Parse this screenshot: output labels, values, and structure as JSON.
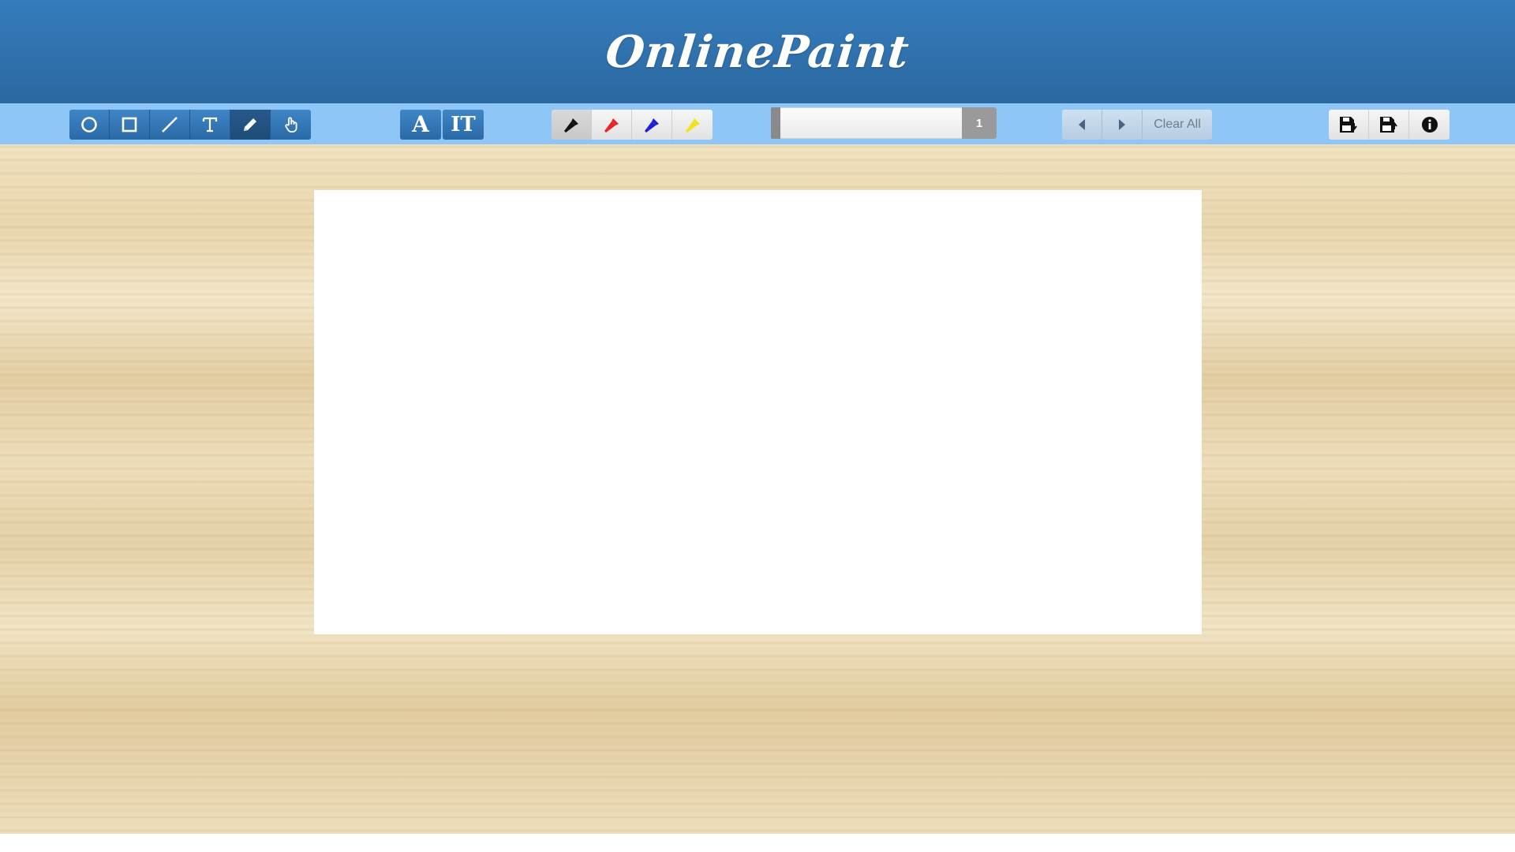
{
  "header": {
    "title": "OnlinePaint"
  },
  "toolbar": {
    "shape_tools": [
      {
        "name": "circle-tool",
        "icon": "circle-icon"
      },
      {
        "name": "rectangle-tool",
        "icon": "square-icon"
      },
      {
        "name": "line-tool",
        "icon": "line-icon"
      },
      {
        "name": "text-tool",
        "icon": "text-icon"
      },
      {
        "name": "pencil-tool",
        "icon": "pencil-icon",
        "active": true
      },
      {
        "name": "hand-tool",
        "icon": "hand-pointer-icon"
      }
    ],
    "font_tools": [
      {
        "name": "font-style-tool",
        "icon": "font-icon",
        "glyph": "A"
      },
      {
        "name": "font-size-tool",
        "icon": "text-height-icon",
        "glyph": "IT"
      }
    ],
    "colors": [
      {
        "name": "black",
        "hex": "#111111",
        "active": true
      },
      {
        "name": "red",
        "hex": "#e8232a"
      },
      {
        "name": "blue",
        "hex": "#1c1fd6"
      },
      {
        "name": "yellow",
        "hex": "#f2e21b"
      }
    ],
    "brush_size": {
      "value": "1"
    },
    "history": {
      "undo_icon": "caret-left-icon",
      "redo_icon": "caret-right-icon",
      "clear_label": "Clear All"
    },
    "file": [
      {
        "name": "save",
        "icon": "save-download-icon"
      },
      {
        "name": "load",
        "icon": "save-upload-icon"
      },
      {
        "name": "info",
        "icon": "info-circle-icon"
      }
    ]
  }
}
